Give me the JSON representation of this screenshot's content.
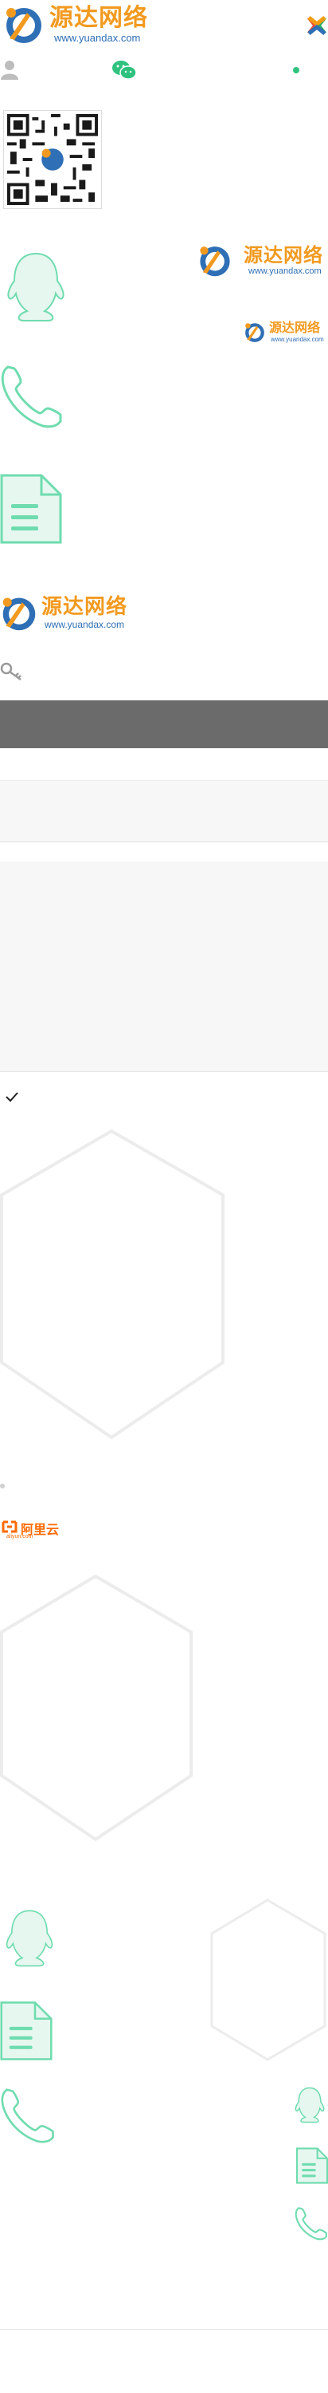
{
  "header": {
    "logo_cn": "源达网络",
    "logo_url": "www.yuandax.com",
    "menu_icon": "colorful-x-icon"
  },
  "topbar": {
    "user_icon": "user-icon",
    "wechat_icon": "wechat-icon",
    "status_color": "#2ec27e"
  },
  "qrcode": {
    "icon": "qr-code"
  },
  "logo_block": {
    "logo_cn": "源达网络",
    "logo_url": "www.yuandax.com"
  },
  "logo_small": {
    "logo_cn": "源达网络",
    "logo_url": "www.yuandax.com"
  },
  "logo_mid": {
    "logo_cn": "源达网络",
    "logo_url": "www.yuandax.com"
  },
  "aliyun": {
    "logo_cn": "阿里云",
    "logo_url": "aliyun.com",
    "color": "#ff6a00"
  },
  "colors": {
    "accent_green": "#6fdcaf",
    "brand_blue": "#2f6fb5",
    "brand_orange": "#f29a1f"
  }
}
